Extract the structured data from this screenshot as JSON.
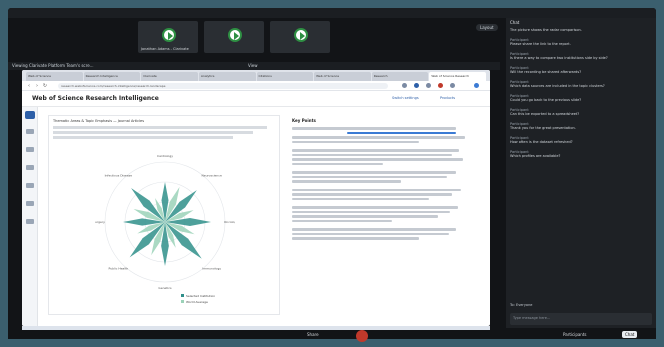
{
  "meeting": {
    "participant_tiles": [
      {
        "label": "Jonathan Adams - Clarivate"
      },
      {
        "label": ""
      },
      {
        "label": ""
      }
    ],
    "top_right_pill": "Layout",
    "share_bar_label": "Viewing Clarivate Platform Team's scre...",
    "share_bar_center": "View"
  },
  "browser": {
    "tabs": [
      "Web of Science",
      "Research Intelligence",
      "Clarivate",
      "Analytics",
      "Citations",
      "Web of Science",
      "Research",
      "Web of Science Research"
    ],
    "url": "research.webofscience.com/research-intelligence/research-landscape"
  },
  "wos": {
    "title": "Web of Science Research Intelligence",
    "right_links": [
      "Switch settings",
      "Products"
    ]
  },
  "panel": {
    "heading": "Thematic Areas & Topic Emphasis — Journal Articles",
    "radar_labels": [
      "Cardiology",
      "Neuroscience",
      "Oncology",
      "Immunology",
      "Genetics",
      "Public Health",
      "Surgery",
      "Infectious Disease"
    ],
    "legend": [
      "Selected Institution",
      "World Average"
    ]
  },
  "right_panel": {
    "heading": "Key Points"
  },
  "chat": {
    "header": "Chat",
    "messages": [
      {
        "name": "",
        "text": "The picture shows the radar comparison."
      },
      {
        "name": "Participant",
        "text": "Please share the link to the report."
      },
      {
        "name": "Participant",
        "text": "Is there a way to compare two institutions side by side?"
      },
      {
        "name": "Participant",
        "text": "Will the recording be shared afterwards?"
      },
      {
        "name": "Participant",
        "text": "Which data sources are included in the topic clusters?"
      },
      {
        "name": "Participant",
        "text": "Could you go back to the previous slide?"
      },
      {
        "name": "Participant",
        "text": "Can this be exported to a spreadsheet?"
      },
      {
        "name": "Participant",
        "text": "Thank you for the great presentation."
      },
      {
        "name": "Participant",
        "text": "How often is the dataset refreshed?"
      },
      {
        "name": "Participant",
        "text": "Which profiles are available?"
      }
    ],
    "to_label": "To: Everyone",
    "input_placeholder": "Type message here..."
  },
  "footer": {
    "share": "Share",
    "participants": "Participants",
    "chat": "Chat"
  },
  "colors": {
    "accent": "#2d5fa8",
    "teal": "#2f8f8a",
    "green": "#2e8f43",
    "leave": "#c0392b"
  }
}
